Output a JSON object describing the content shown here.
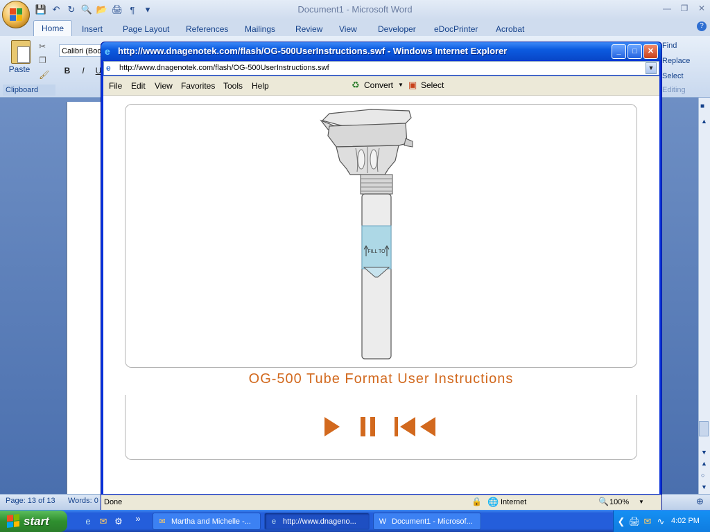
{
  "word": {
    "title": "Document1 - Microsoft Word",
    "tabs": [
      "Home",
      "Insert",
      "Page Layout",
      "References",
      "Mailings",
      "Review",
      "View",
      "Developer",
      "eDocPrinter",
      "Acrobat"
    ],
    "font_name": "Calibri (Bod",
    "paste_label": "Paste",
    "clipboard_label": "Clipboard",
    "editing_items": [
      "Find",
      "Replace",
      "Select"
    ],
    "editing_label": "Editing",
    "status_page": "Page: 13 of 13",
    "status_words": "Words: 0"
  },
  "ie": {
    "title": "http://www.dnagenotek.com/flash/OG-500UserInstructions.swf - Windows Internet Explorer",
    "address": "http://www.dnagenotek.com/flash/OG-500UserInstructions.swf",
    "menu": [
      "File",
      "Edit",
      "View",
      "Favorites",
      "Tools",
      "Help"
    ],
    "convert_label": "Convert",
    "select_label": "Select",
    "status_text": "Done",
    "zone_text": "Internet",
    "zoom": "100%"
  },
  "flash": {
    "title": "OG-500 Tube Format User Instructions",
    "fill_label": "FILL TO",
    "accent_color": "#d2691e",
    "fill_color": "#add8e6"
  },
  "taskbar": {
    "start_label": "start",
    "buttons": [
      "Martha and Michelle -...",
      "http://www.dnageno...",
      "Document1 - Microsof..."
    ],
    "clock": "4:02 PM"
  }
}
